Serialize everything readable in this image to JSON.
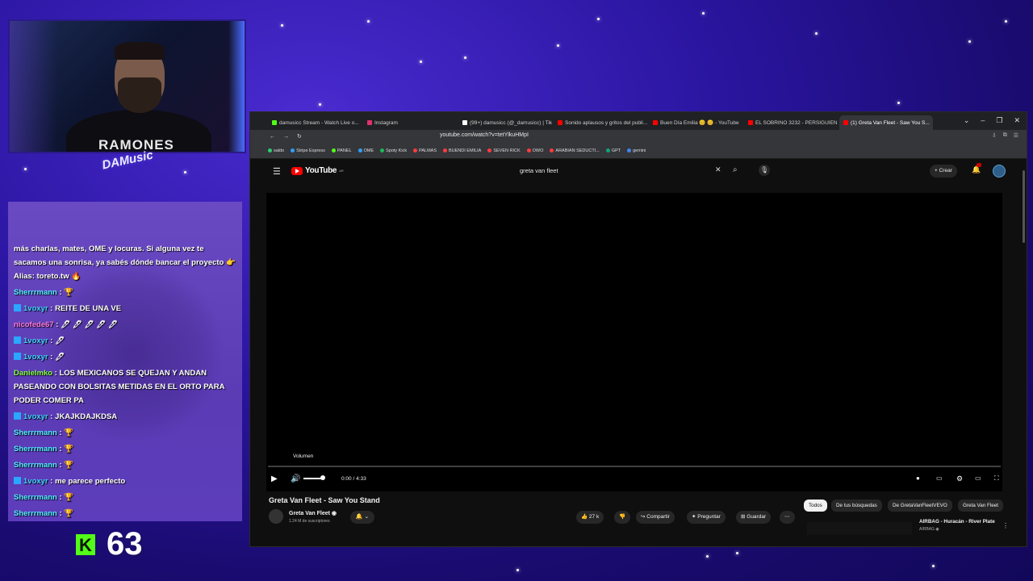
{
  "webcam": {
    "shirt_text": "RAMONES",
    "logo_text": "DAMusic"
  },
  "chat": {
    "messages": [
      {
        "user": "",
        "text": "más charlas, mates, OME y locuras. Si alguna vez te sacamos una sonrisa, ya sabés dónde bancar el proyecto 👉 Alias: toreto.tw 🔥"
      },
      {
        "user": "Sherrrmann",
        "text": " : 🏆"
      },
      {
        "user": "1voxyr",
        "text": " : REITE DE UNA VE"
      },
      {
        "user": "nicofede67",
        "text": " : 🖊 🖊 🖊 🖊 🖊"
      },
      {
        "user": "1voxyr",
        "text": " : 🖊"
      },
      {
        "user": "1voxyr",
        "text": " : 🖊"
      },
      {
        "user": "Danielmko",
        "text": " : LOS MEXICANOS SE QUEJAN Y ANDAN PASEANDO CON BOLSITAS METIDAS EN EL ORTO PARA PODER COMER PA"
      },
      {
        "user": "1voxyr",
        "text": " : JKAJKDAJKDSA"
      },
      {
        "user": "Sherrrmann",
        "text": " : 🏆"
      },
      {
        "user": "Sherrrmann",
        "text": " : 🏆"
      },
      {
        "user": "Sherrrmann",
        "text": " : 🏆"
      },
      {
        "user": "1voxyr",
        "text": " : me parece perfecto"
      },
      {
        "user": "Sherrrmann",
        "text": " : 🏆"
      },
      {
        "user": "Sherrrmann",
        "text": " : 🏆"
      }
    ]
  },
  "kick": {
    "icon": "kick-logo-icon",
    "viewer_count": "63"
  },
  "browser": {
    "tabs": [
      {
        "label": "damusicc Stream - Watch Live o...",
        "color": "#53fc18"
      },
      {
        "label": "Instagram",
        "color": "#e1306c"
      },
      {
        "label": "(99+) damusicc (@_damusicc) | TikT...",
        "color": "#ffffff"
      },
      {
        "label": "Sonido aplausos y gritos del publi...",
        "color": "#ff0000"
      },
      {
        "label": "Buen Día Emilia 😊 😊 - YouTube",
        "color": "#ff0000"
      },
      {
        "label": "EL SOBRINO 3232 - PERSIGUIEND...",
        "color": "#ff0000"
      },
      {
        "label": "(1) Greta Van Fleet - Saw You S...",
        "color": "#ff0000"
      }
    ],
    "url": "youtube.com/watch?v=tetYlkuHMpI",
    "bookmarks": [
      "saldo",
      "Stripe Express",
      "PANEL",
      "OME",
      "Spoty Kick",
      "PALMAS",
      "BUENDI EMILIA",
      "SEVEN RICK",
      "OWO",
      "ARABIAN SEDUCTI...",
      "GPT",
      "gemini"
    ],
    "window_controls": [
      "⌄",
      "–",
      "❐",
      "✕"
    ]
  },
  "youtube": {
    "logo_text": "YouTube",
    "country_code": "AR",
    "search_value": "greta van fleet",
    "create_label": "Crear",
    "volume_tooltip": "Volumen",
    "time": "0:00 / 4:33",
    "video_title": "Greta Van Fleet - Saw You Stand",
    "channel_name": "Greta Van Fleet ◉",
    "subscribers": "1.24 M de suscriptores",
    "likes": "27 k",
    "share_label": "Compartir",
    "ask_label": "Preguntar",
    "save_label": "Guardar",
    "chips": [
      "Todos",
      "De tus búsquedas",
      "De GretaVanFleetVEVO",
      "Greta Van Fleet"
    ],
    "related_title": "AIRBAG - Huracán - River Plate",
    "related_channel": "AIRBAG ◉"
  }
}
